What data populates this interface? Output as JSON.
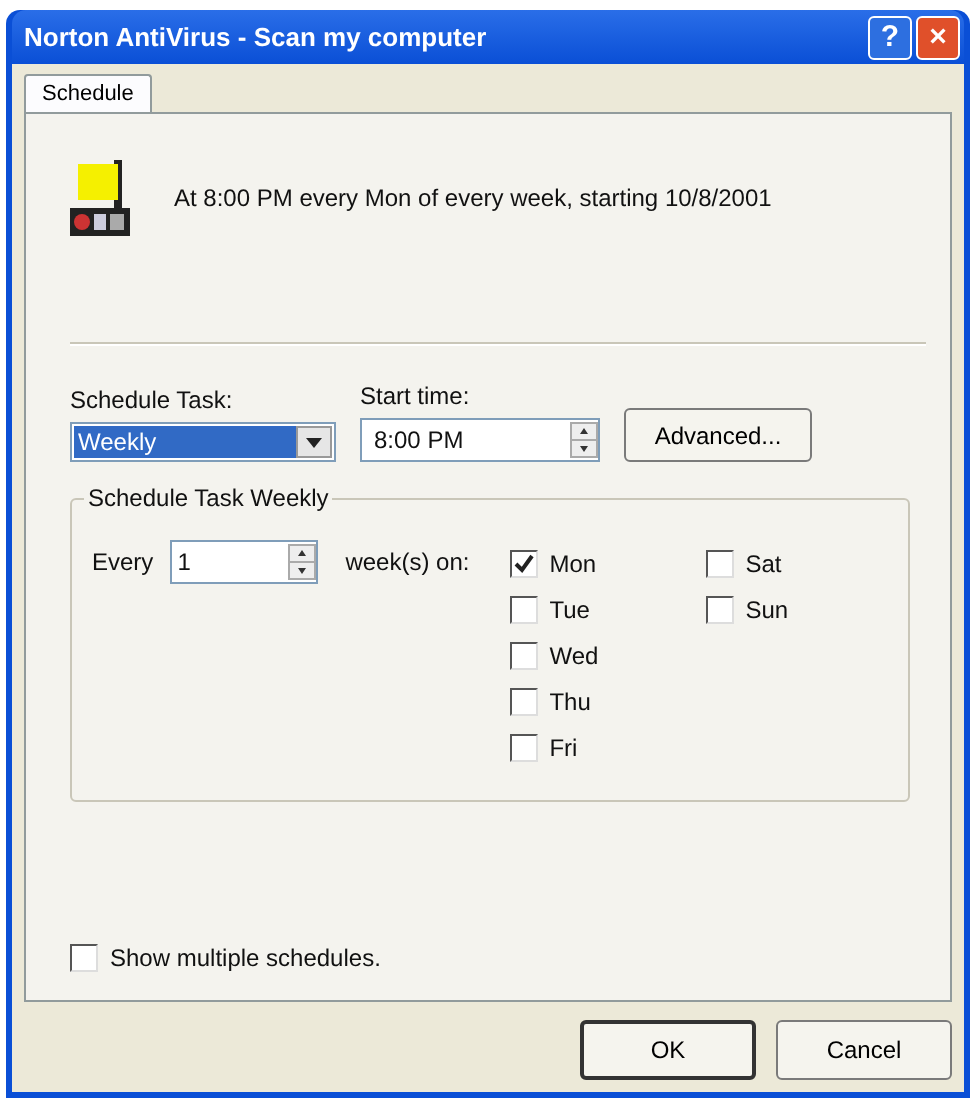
{
  "window": {
    "title": "Norton AntiVirus - Scan my computer",
    "controls": [
      "?",
      "×"
    ]
  },
  "tabs": [
    {
      "label": "Schedule",
      "selected": true
    }
  ],
  "summary": "At 8:00 PM every Mon of every week, starting 10/8/2001",
  "schedule_task": {
    "label": "Schedule Task:",
    "value": "Weekly"
  },
  "start_time": {
    "label": "Start time:",
    "value": "8:00 PM"
  },
  "advanced_button": "Advanced...",
  "weekly_group": {
    "title": "Schedule Task Weekly",
    "every_label": "Every",
    "every_value": "1",
    "weeks_on_label": "week(s) on:",
    "days": [
      {
        "label": "Mon",
        "checked": true
      },
      {
        "label": "Tue",
        "checked": false
      },
      {
        "label": "Wed",
        "checked": false
      },
      {
        "label": "Thu",
        "checked": false
      },
      {
        "label": "Fri",
        "checked": false
      },
      {
        "label": "Sat",
        "checked": false
      },
      {
        "label": "Sun",
        "checked": false
      }
    ]
  },
  "show_multiple": {
    "label": "Show multiple schedules.",
    "checked": false
  },
  "buttons": [
    {
      "label": "OK",
      "default": true
    },
    {
      "label": "Cancel",
      "default": false
    }
  ]
}
